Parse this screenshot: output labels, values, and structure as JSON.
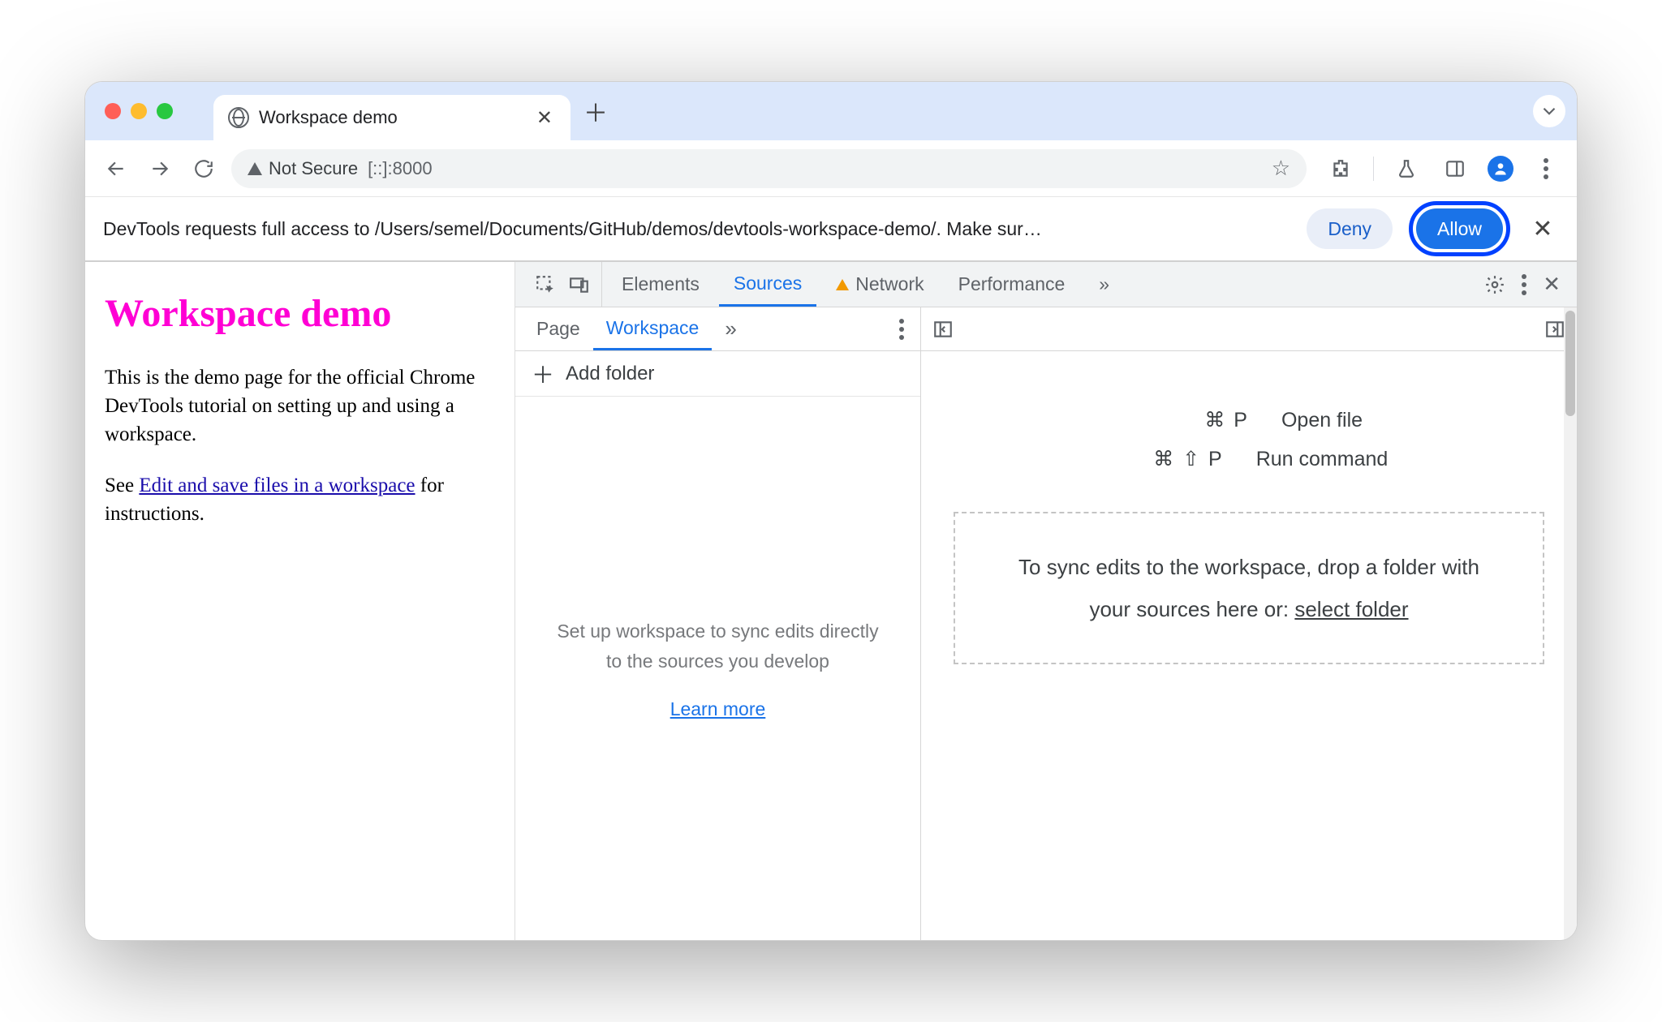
{
  "browser": {
    "tab_title": "Workspace demo",
    "not_secure_label": "Not Secure",
    "url": "[::]:8000"
  },
  "infobar": {
    "message": "DevTools requests full access to /Users/semel/Documents/GitHub/demos/devtools-workspace-demo/. Make sur…",
    "deny": "Deny",
    "allow": "Allow"
  },
  "page": {
    "heading": "Workspace demo",
    "para1": "This is the demo page for the official Chrome DevTools tutorial on setting up and using a workspace.",
    "para2_pre": "See ",
    "para2_link": "Edit and save files in a workspace",
    "para2_post": " for instructions."
  },
  "devtools": {
    "tabs": {
      "elements": "Elements",
      "sources": "Sources",
      "network": "Network",
      "performance": "Performance"
    },
    "nav_tabs": {
      "page": "Page",
      "workspace": "Workspace"
    },
    "add_folder": "Add folder",
    "workspace_empty": "Set up workspace to sync edits directly to the sources you develop",
    "learn_more": "Learn more",
    "shortcuts": {
      "open_file_keys": "⌘ P",
      "open_file": "Open file",
      "run_cmd_keys": "⌘ ⇧ P",
      "run_cmd": "Run command"
    },
    "dropzone": {
      "line": "To sync edits to the workspace, drop a folder with your sources here or: ",
      "select": "select folder"
    }
  }
}
